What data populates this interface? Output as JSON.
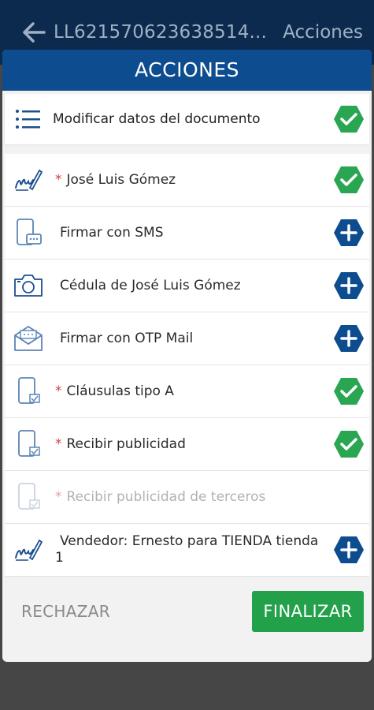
{
  "topbar": {
    "title": "LL621570623638514...",
    "action_label": "Acciones"
  },
  "dialog": {
    "title": "ACCIONES",
    "doc_row": {
      "label": "Modificar datos del documento",
      "icon": "list-icon",
      "status": "done"
    },
    "items": [
      {
        "required": "*",
        "label": "José Luis Gómez",
        "icon": "signature-icon",
        "status": "done",
        "disabled": false
      },
      {
        "required": "",
        "label": "Firmar con SMS",
        "icon": "phone-sms-icon",
        "status": "add",
        "disabled": false
      },
      {
        "required": "",
        "label": "Cédula de José Luis Gómez",
        "icon": "camera-icon",
        "status": "add",
        "disabled": false
      },
      {
        "required": "",
        "label": "Firmar con OTP Mail",
        "icon": "mail-icon",
        "status": "add",
        "disabled": false
      },
      {
        "required": "*",
        "label": "Cláusulas tipo A",
        "icon": "device-check-icon",
        "status": "done",
        "disabled": false
      },
      {
        "required": "*",
        "label": "Recibir publicidad",
        "icon": "device-check-icon",
        "status": "done",
        "disabled": false
      },
      {
        "required": "*",
        "label": "Recibir publicidad de terceros",
        "icon": "device-check-icon",
        "status": "none",
        "disabled": true
      },
      {
        "required": "",
        "label": "Vendedor: Ernesto para TIENDA tienda 1",
        "icon": "signature-icon",
        "status": "add",
        "disabled": false
      }
    ],
    "reject_label": "RECHAZAR",
    "finish_label": "FINALIZAR"
  },
  "colors": {
    "header_blue": "#0d4c8f",
    "topbar": "#0c2a4d",
    "done_green": "#2aa653",
    "add_blue": "#0d4c8f",
    "finish_green": "#22a04a"
  }
}
